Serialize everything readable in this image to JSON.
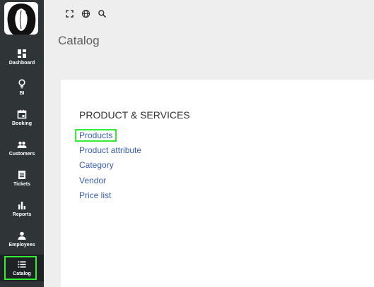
{
  "page_title": "Catalog",
  "sidebar": {
    "items": [
      {
        "label": "Dashboard",
        "icon": "dashboard-icon"
      },
      {
        "label": "BI",
        "icon": "lightbulb-icon"
      },
      {
        "label": "Booking",
        "icon": "calendar-icon"
      },
      {
        "label": "Customers",
        "icon": "people-icon"
      },
      {
        "label": "Tickets",
        "icon": "ticket-icon"
      },
      {
        "label": "Reports",
        "icon": "bar-chart-icon"
      },
      {
        "label": "Employees",
        "icon": "person-icon"
      },
      {
        "label": "Catalog",
        "icon": "list-icon",
        "active": true
      }
    ]
  },
  "toolbar": {
    "icons": [
      "fullscreen-icon",
      "globe-icon",
      "search-icon"
    ]
  },
  "section": {
    "title": "PRODUCT & SERVICES",
    "links": [
      "Products",
      "Product attribute",
      "Category",
      "Vendor",
      "Price list"
    ]
  },
  "colors": {
    "sidebar": "#2f3436",
    "highlight": "#33ee33",
    "link": "#3a5fb5"
  }
}
